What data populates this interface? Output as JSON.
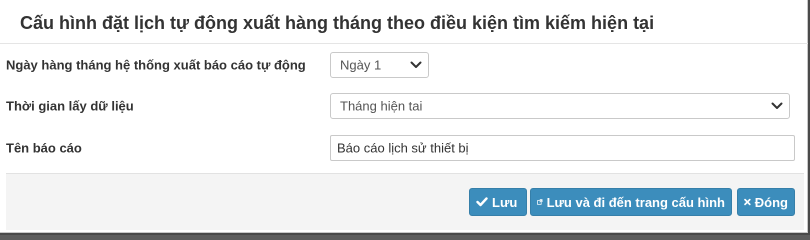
{
  "dialog": {
    "title": "Cấu hình đặt lịch tự động xuất hàng tháng theo điều kiện tìm kiếm hiện tại"
  },
  "form": {
    "day_label": "Ngày hàng tháng hệ thống xuất báo cáo tự động",
    "day_value": "Ngày 1",
    "period_label": "Thời gian lấy dữ liệu",
    "period_value": "Tháng hiện tai",
    "report_name_label": "Tên báo cáo",
    "report_name_value": "Báo cáo lịch sử thiết bị"
  },
  "footer": {
    "save_label": "Lưu",
    "save_go_label": "Lưu và đi đến trang cấu hình",
    "close_label": "Đóng"
  },
  "colors": {
    "primary": "#3c8dbc",
    "footer_bg": "#f4f4f4"
  },
  "icons": {
    "save": "check-icon",
    "save_go": "external-link-icon",
    "close": "close-icon",
    "select": "chevron-down-icon"
  }
}
